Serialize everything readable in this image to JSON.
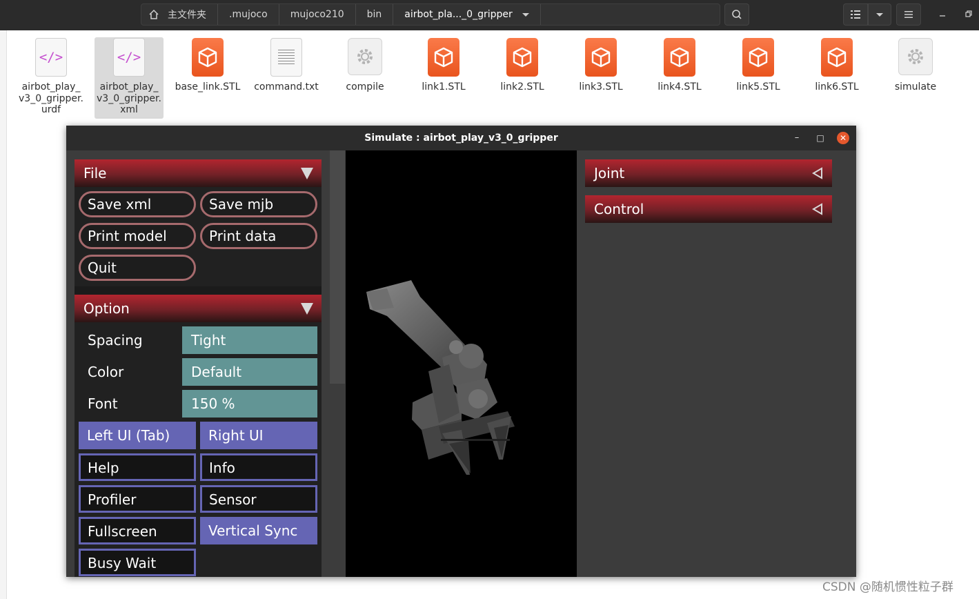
{
  "file_manager": {
    "breadcrumbs": [
      "主文件夹",
      ".mujoco",
      "mujoco210",
      "bin",
      "airbot_pla..._0_gripper"
    ],
    "files": [
      {
        "name": "airbot_play_\nv3_0_gripper.\nurdf",
        "icon": "code-file-icon",
        "selected": false
      },
      {
        "name": "airbot_play_\nv3_0_gripper.\nxml",
        "icon": "code-file-icon",
        "selected": true
      },
      {
        "name": "base_link.STL",
        "icon": "stl-file-icon",
        "selected": false
      },
      {
        "name": "command.txt",
        "icon": "text-file-icon",
        "selected": false
      },
      {
        "name": "compile",
        "icon": "executable-icon",
        "selected": false
      },
      {
        "name": "link1.STL",
        "icon": "stl-file-icon",
        "selected": false
      },
      {
        "name": "link2.STL",
        "icon": "stl-file-icon",
        "selected": false
      },
      {
        "name": "link3.STL",
        "icon": "stl-file-icon",
        "selected": false
      },
      {
        "name": "link4.STL",
        "icon": "stl-file-icon",
        "selected": false
      },
      {
        "name": "link5.STL",
        "icon": "stl-file-icon",
        "selected": false
      },
      {
        "name": "link6.STL",
        "icon": "stl-file-icon",
        "selected": false
      },
      {
        "name": "simulate",
        "icon": "executable-icon",
        "selected": false
      }
    ],
    "code_glyph": "</>"
  },
  "simulate": {
    "title": "Simulate : airbot_play_v3_0_gripper",
    "window_buttons": {
      "minimize": "–",
      "maximize": "□",
      "close": "✕"
    },
    "file_section": {
      "label": "File",
      "buttons": [
        "Save xml",
        "Save mjb",
        "Print model",
        "Print data",
        "Quit"
      ]
    },
    "option_section": {
      "label": "Option",
      "rows": [
        {
          "label": "Spacing",
          "value": "Tight"
        },
        {
          "label": "Color",
          "value": "Default"
        },
        {
          "label": "Font",
          "value": "150 %"
        }
      ],
      "toggles": [
        {
          "label": "Left UI (Tab)",
          "on": true
        },
        {
          "label": "Right UI",
          "on": true
        },
        {
          "label": "Help",
          "on": false
        },
        {
          "label": "Info",
          "on": false
        },
        {
          "label": "Profiler",
          "on": false
        },
        {
          "label": "Sensor",
          "on": false
        },
        {
          "label": "Fullscreen",
          "on": false
        },
        {
          "label": "Vertical Sync",
          "on": true
        },
        {
          "label": "Busy Wait",
          "on": false
        }
      ]
    },
    "right_sections": [
      "Joint",
      "Control"
    ]
  },
  "colors": {
    "section_header_red": "#b2252f",
    "pill_border": "#a66a6d",
    "select_teal": "#629595",
    "toggle_purple": "#6565b4",
    "stl_orange": "#f26a32"
  },
  "watermark": "CSDN @随机惯性粒子群"
}
